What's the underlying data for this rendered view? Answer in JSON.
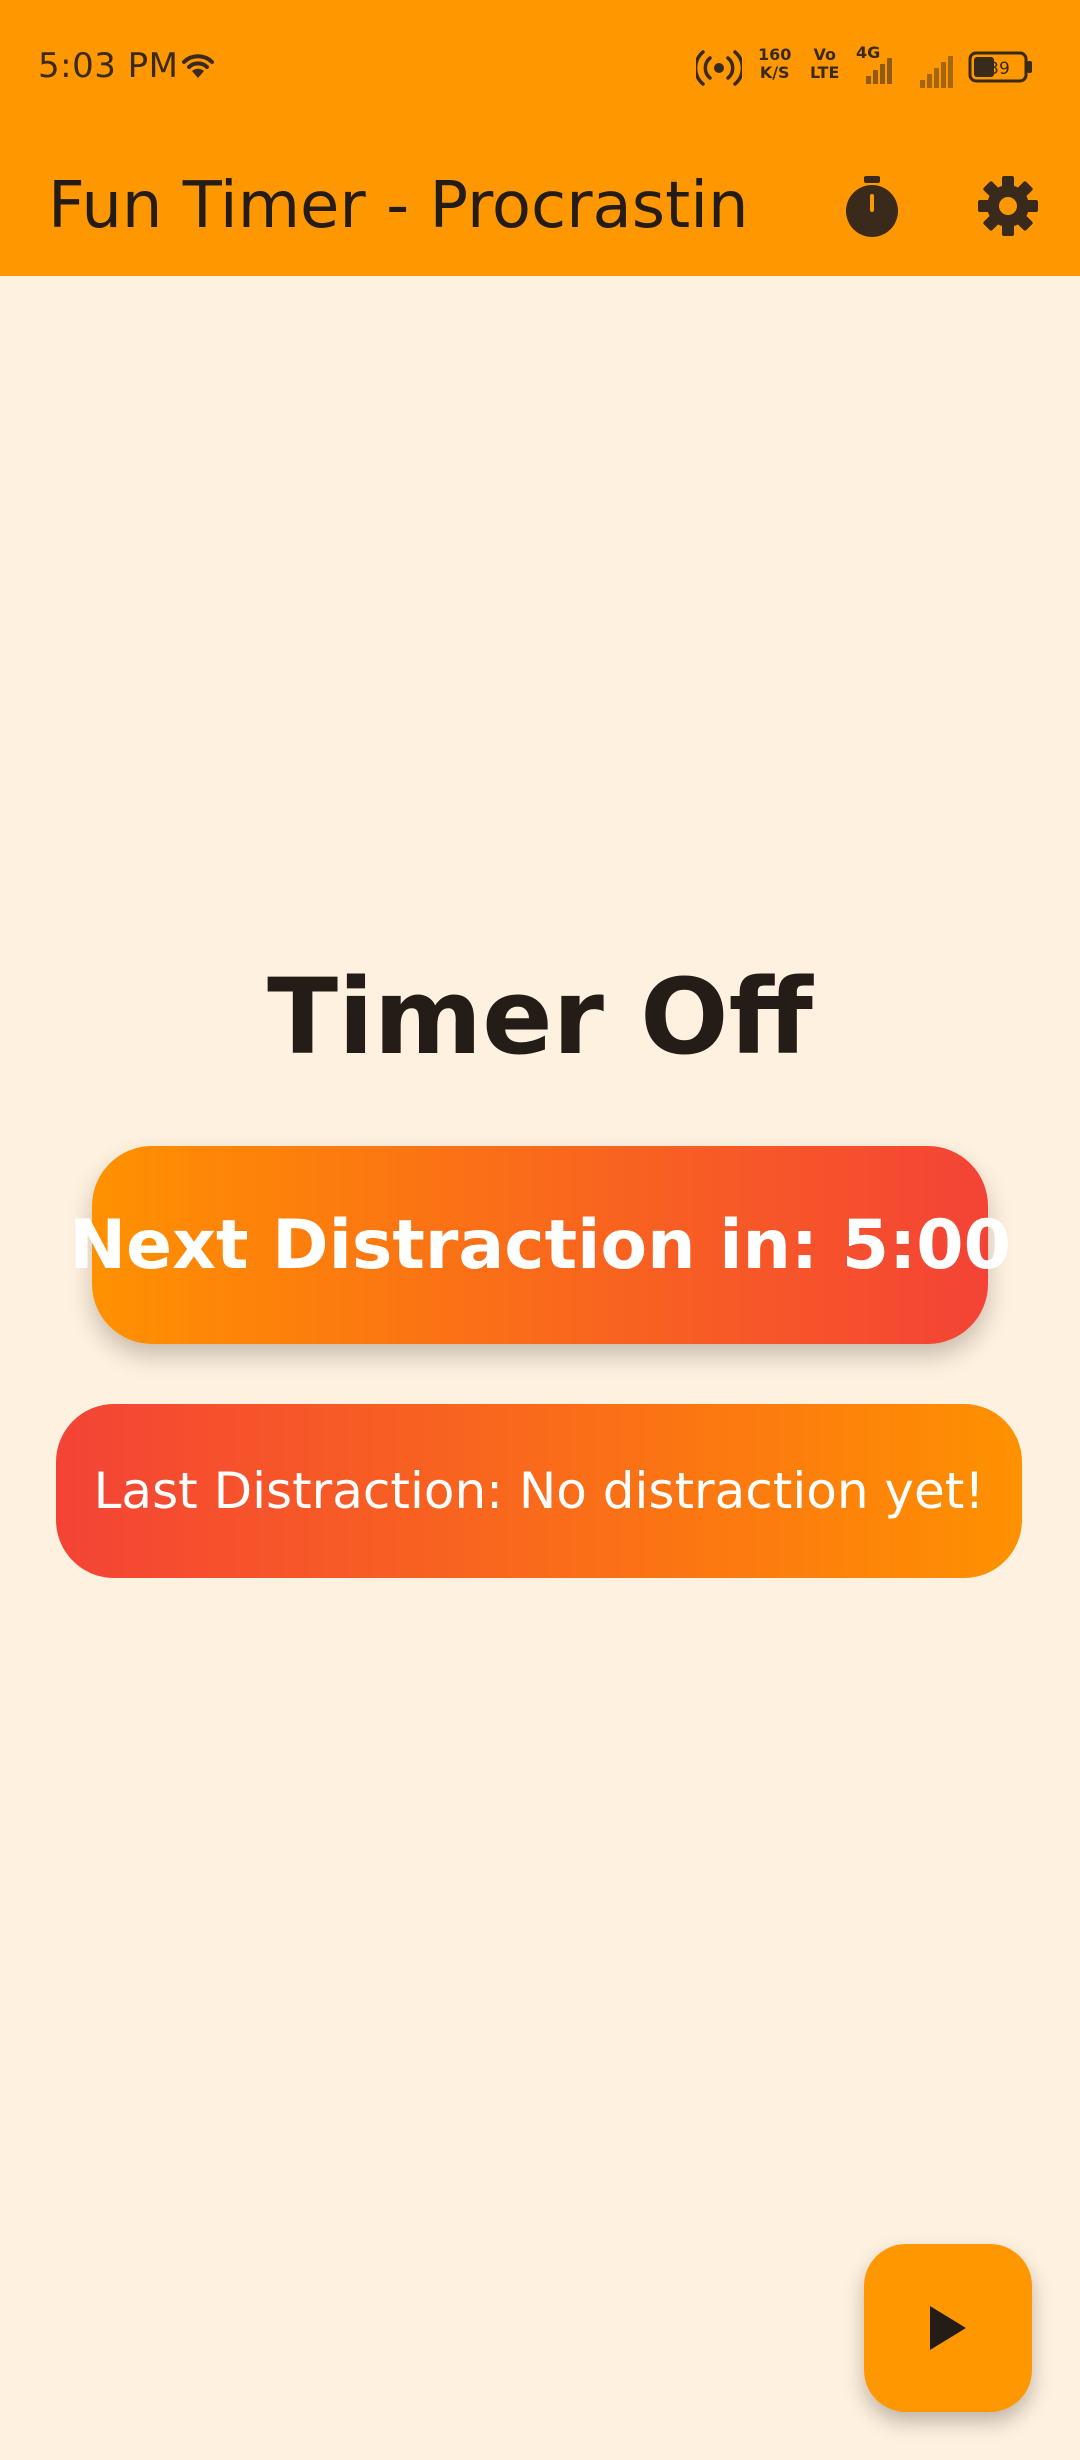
{
  "status_bar": {
    "time": "5:03 PM",
    "speed_value": "160",
    "speed_unit": "K/S",
    "volte_top": "Vo",
    "volte_bottom": "LTE",
    "network": "4G",
    "battery": "39",
    "icons": [
      "wifi-icon",
      "hotspot-icon",
      "signal-icon",
      "battery-icon"
    ]
  },
  "app_bar": {
    "title": "Fun Timer - Procrastin…",
    "icons": [
      "stopwatch-icon",
      "gear-icon"
    ]
  },
  "main": {
    "timer_status": "Timer Off",
    "next_distraction": "Next Distraction in: 5:00",
    "last_distraction": "Last Distraction: No distraction yet!"
  },
  "fab": {
    "icon": "play-icon"
  },
  "colors": {
    "primary": "#FF9800",
    "background": "#FFF1DF",
    "gradient_orange": "#FF9100",
    "gradient_red": "#F44336",
    "text_dark": "#241C16"
  }
}
